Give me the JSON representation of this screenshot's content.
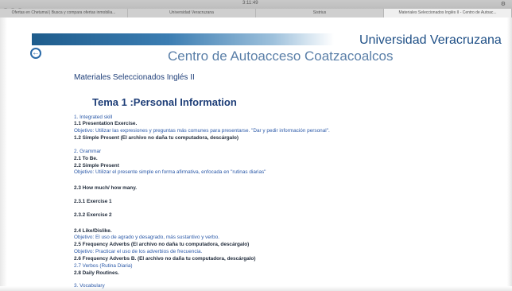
{
  "browser": {
    "time": "3:11:49",
    "tabs": [
      "Ofertas en Chetumal | Busca y compara ofertas inmobilia...",
      "Universidad Veracruzana",
      "Sistrius",
      "Materiales Seleccionados Inglés II - Centro de Autoac..."
    ]
  },
  "header": {
    "university": "Universidad Veracruzana",
    "centro": "Centro de Autoacceso Coatzacoalcos",
    "back_icon": "circle-arrow-left-icon"
  },
  "content": {
    "section_title": "Materiales Seleccionados Inglés II",
    "tema_title": "Tema 1 :Personal Information",
    "lines": [
      {
        "text": "1. Integrated skill",
        "style": "blue"
      },
      {
        "text": "1.1 Presentation Exercise.",
        "style": "dark"
      },
      {
        "text": "Objetivo: Utilizar las expresiones y preguntas más comunes para presentarse. \"Dar y pedir información personal\".",
        "style": "blue"
      },
      {
        "text": "1.2 Simple Present   (El archivo no daña tu computadora, descárgalo)",
        "style": "dark"
      },
      {
        "text": "2. Grammar",
        "style": "blue"
      },
      {
        "text": "2.1  To Be.",
        "style": "dark"
      },
      {
        "text": "2.2 Simple Present",
        "style": "dark"
      },
      {
        "text": "Objetivo: Utilizar el presente simple en forma afirmativa, enfocada en \"rutinas diarias\"",
        "style": "blue"
      },
      {
        "text": "2.3 How much/ how many.",
        "style": "dark"
      },
      {
        "text": "2.3.1 Exercise 1",
        "style": "dark"
      },
      {
        "text": "2.3.2 Exercise 2",
        "style": "dark"
      },
      {
        "text": "2.4 Like/Dislike.",
        "style": "dark"
      },
      {
        "text": "Objetivo: El uso de agrado y desagrado, más sustantivo y verbo.",
        "style": "blue"
      },
      {
        "text": "2.5 Frequency Adverbs (El archivo no daña tu computadora, descárgalo)",
        "style": "dark"
      },
      {
        "text": "Objetivo: Practicar el uso de los adverbios de frecuencia.",
        "style": "blue"
      },
      {
        "text": "2.6 Frequency Adverbs B. (El archivo no daña tu computadora, descárgalo)",
        "style": "dark"
      },
      {
        "text": "2.7 Verbos (Rutina Diaria)",
        "style": "blue"
      },
      {
        "text": "2.8 Daily Routines.",
        "style": "dark"
      },
      {
        "text": "3. Vocabulary",
        "style": "blue"
      }
    ]
  }
}
